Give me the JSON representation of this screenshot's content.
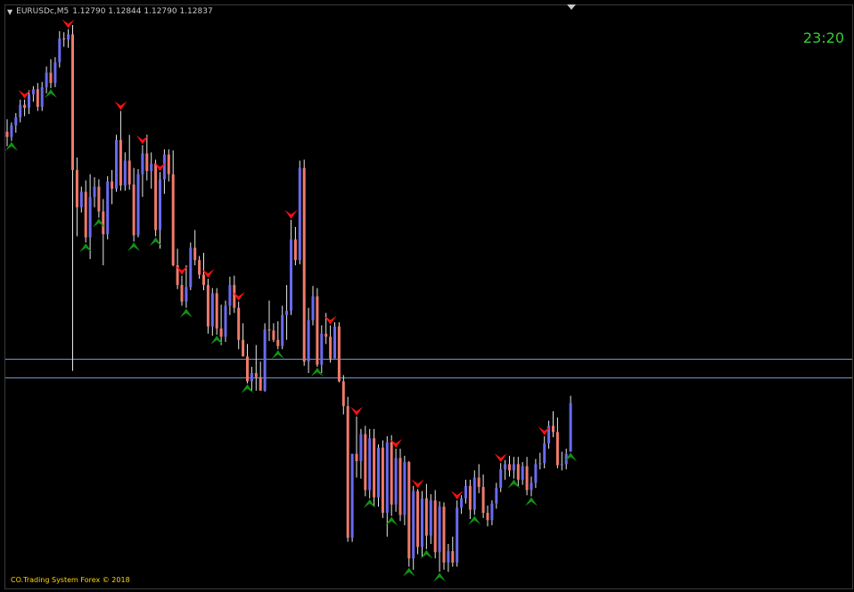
{
  "header": {
    "symbol": "EURUSDc,M5",
    "ohlc": "1.12790 1.12844 1.12790 1.12837"
  },
  "clock": "23:20",
  "footer": "CO.Trading System Forex © 2018",
  "colors": {
    "background": "#000000",
    "bull": "#6a6af0",
    "bear": "#f07a6a",
    "wick": "#e8e8e8",
    "level_line": "#6f98c4",
    "sell_arrow": "#ff1010",
    "buy_arrow": "#129212"
  },
  "chart_data": {
    "type": "candlestick",
    "symbol": "EURUSDc",
    "timeframe": "M5",
    "candles": [
      [
        1.13099,
        1.13111,
        1.13085,
        1.13094
      ],
      [
        1.13094,
        1.13108,
        1.1309,
        1.13105
      ],
      [
        1.13105,
        1.13117,
        1.13098,
        1.13113
      ],
      [
        1.13113,
        1.1313,
        1.13108,
        1.13125
      ],
      [
        1.13125,
        1.1313,
        1.13114,
        1.13122
      ],
      [
        1.13122,
        1.13139,
        1.13116,
        1.13135
      ],
      [
        1.13135,
        1.13143,
        1.13128,
        1.1314
      ],
      [
        1.1314,
        1.13146,
        1.13119,
        1.13123
      ],
      [
        1.13123,
        1.13147,
        1.13119,
        1.13142
      ],
      [
        1.13142,
        1.13162,
        1.13136,
        1.13156
      ],
      [
        1.13156,
        1.13169,
        1.13141,
        1.13146
      ],
      [
        1.13146,
        1.13171,
        1.13142,
        1.13166
      ],
      [
        1.13166,
        1.13196,
        1.13161,
        1.13189
      ],
      [
        1.13189,
        1.13195,
        1.13181,
        1.13188
      ],
      [
        1.13188,
        1.13198,
        1.1318,
        1.13193
      ],
      [
        1.13193,
        1.13202,
        1.12868,
        1.13062
      ],
      [
        1.13062,
        1.13074,
        1.12998,
        1.13026
      ],
      [
        1.13026,
        1.13046,
        1.13021,
        1.13041
      ],
      [
        1.13041,
        1.13052,
        1.12992,
        1.12997
      ],
      [
        1.12997,
        1.13058,
        1.12976,
        1.13036
      ],
      [
        1.13036,
        1.13055,
        1.13026,
        1.13046
      ],
      [
        1.13046,
        1.13053,
        1.13016,
        1.13022
      ],
      [
        1.13022,
        1.13034,
        1.1297,
        1.13
      ],
      [
        1.13,
        1.13056,
        1.12995,
        1.13051
      ],
      [
        1.13051,
        1.13062,
        1.13029,
        1.13044
      ],
      [
        1.13044,
        1.13096,
        1.13041,
        1.13091
      ],
      [
        1.13091,
        1.13119,
        1.13042,
        1.13047
      ],
      [
        1.13047,
        1.13079,
        1.13042,
        1.13071
      ],
      [
        1.13071,
        1.13096,
        1.13043,
        1.13048
      ],
      [
        1.13048,
        1.13064,
        1.12993,
        1.12999
      ],
      [
        1.12999,
        1.13063,
        1.12997,
        1.13058
      ],
      [
        1.13058,
        1.13086,
        1.13036,
        1.13078
      ],
      [
        1.13078,
        1.13096,
        1.13052,
        1.13061
      ],
      [
        1.13061,
        1.13079,
        1.13044,
        1.13068
      ],
      [
        1.13068,
        1.13072,
        1.12998,
        1.13004
      ],
      [
        1.13004,
        1.1306,
        1.12986,
        1.13053
      ],
      [
        1.13053,
        1.13082,
        1.13039,
        1.13077
      ],
      [
        1.13077,
        1.13082,
        1.13051,
        1.13058
      ],
      [
        1.13058,
        1.13081,
        1.12969,
        1.1297
      ],
      [
        1.1297,
        1.12986,
        1.12947,
        1.12951
      ],
      [
        1.12951,
        1.1296,
        1.12931,
        1.12935
      ],
      [
        1.12935,
        1.1297,
        1.12929,
        1.12949
      ],
      [
        1.12949,
        1.12992,
        1.12946,
        1.12987
      ],
      [
        1.12987,
        1.13004,
        1.1297,
        1.12975
      ],
      [
        1.12975,
        1.12979,
        1.12957,
        1.12961
      ],
      [
        1.12961,
        1.12982,
        1.12946,
        1.12951
      ],
      [
        1.12951,
        1.12957,
        1.12904,
        1.12911
      ],
      [
        1.12911,
        1.12948,
        1.12902,
        1.12943
      ],
      [
        1.12943,
        1.12948,
        1.12903,
        1.12909
      ],
      [
        1.12909,
        1.12932,
        1.12893,
        1.12901
      ],
      [
        1.12901,
        1.12936,
        1.12896,
        1.12931
      ],
      [
        1.12931,
        1.12959,
        1.12922,
        1.12951
      ],
      [
        1.12951,
        1.1296,
        1.12924,
        1.12929
      ],
      [
        1.12929,
        1.12935,
        1.12889,
        1.12898
      ],
      [
        1.12898,
        1.12914,
        1.12882,
        1.12882
      ],
      [
        1.12882,
        1.12894,
        1.12856,
        1.12858
      ],
      [
        1.12858,
        1.12872,
        1.12849,
        1.12866
      ],
      [
        1.12866,
        1.12893,
        1.12849,
        1.12862
      ],
      [
        1.12862,
        1.12877,
        1.12849,
        1.12849
      ],
      [
        1.12849,
        1.12914,
        1.12848,
        1.12908
      ],
      [
        1.12908,
        1.12936,
        1.12897,
        1.12907
      ],
      [
        1.12907,
        1.12914,
        1.12896,
        1.12898
      ],
      [
        1.12898,
        1.12916,
        1.12889,
        1.12892
      ],
      [
        1.12892,
        1.12931,
        1.12889,
        1.12922
      ],
      [
        1.12922,
        1.12951,
        1.12898,
        1.12926
      ],
      [
        1.12926,
        1.13014,
        1.12922,
        1.12995
      ],
      [
        1.12995,
        1.13007,
        1.1297,
        1.12975
      ],
      [
        1.12975,
        1.13071,
        1.12971,
        1.13064
      ],
      [
        1.13064,
        1.13072,
        1.12873,
        1.12877
      ],
      [
        1.12877,
        1.12929,
        1.12866,
        1.12917
      ],
      [
        1.12917,
        1.1295,
        1.12912,
        1.1294
      ],
      [
        1.1294,
        1.12948,
        1.12872,
        1.12874
      ],
      [
        1.12874,
        1.12912,
        1.12866,
        1.12904
      ],
      [
        1.12904,
        1.12924,
        1.12894,
        1.12901
      ],
      [
        1.12901,
        1.12912,
        1.12876,
        1.1288
      ],
      [
        1.1288,
        1.12915,
        1.12881,
        1.12911
      ],
      [
        1.12911,
        1.12915,
        1.12857,
        1.12858
      ],
      [
        1.12858,
        1.12864,
        1.12826,
        1.12834
      ],
      [
        1.12834,
        1.12843,
        1.12703,
        1.12707
      ],
      [
        1.12707,
        1.12788,
        1.12703,
        1.12788
      ],
      [
        1.12788,
        1.12824,
        1.12765,
        1.12781
      ],
      [
        1.12781,
        1.12812,
        1.12764,
        1.12807
      ],
      [
        1.12807,
        1.12815,
        1.12747,
        1.12753
      ],
      [
        1.12753,
        1.12812,
        1.12745,
        1.12803
      ],
      [
        1.12803,
        1.12812,
        1.12737,
        1.12746
      ],
      [
        1.12746,
        1.12797,
        1.12737,
        1.12794
      ],
      [
        1.12794,
        1.12801,
        1.12726,
        1.12731
      ],
      [
        1.12731,
        1.12805,
        1.12708,
        1.12799
      ],
      [
        1.12799,
        1.12806,
        1.12728,
        1.12739
      ],
      [
        1.12739,
        1.12793,
        1.12732,
        1.12784
      ],
      [
        1.12784,
        1.12793,
        1.12723,
        1.12729
      ],
      [
        1.12729,
        1.12786,
        1.12719,
        1.1278
      ],
      [
        1.1278,
        1.12781,
        1.12679,
        1.12687
      ],
      [
        1.12687,
        1.12757,
        1.12676,
        1.12752
      ],
      [
        1.12752,
        1.12754,
        1.12691,
        1.12698
      ],
      [
        1.12698,
        1.12752,
        1.12688,
        1.12745
      ],
      [
        1.12745,
        1.12759,
        1.12696,
        1.12709
      ],
      [
        1.12709,
        1.12749,
        1.12701,
        1.12743
      ],
      [
        1.12743,
        1.12753,
        1.12687,
        1.12693
      ],
      [
        1.12693,
        1.12742,
        1.12674,
        1.12737
      ],
      [
        1.12737,
        1.12741,
        1.12676,
        1.12683
      ],
      [
        1.12683,
        1.12701,
        1.12674,
        1.12694
      ],
      [
        1.12694,
        1.12708,
        1.12679,
        1.12683
      ],
      [
        1.12683,
        1.12743,
        1.12679,
        1.12736
      ],
      [
        1.12736,
        1.12748,
        1.1273,
        1.12745
      ],
      [
        1.12745,
        1.12763,
        1.1274,
        1.12757
      ],
      [
        1.12757,
        1.12763,
        1.12725,
        1.12734
      ],
      [
        1.12734,
        1.12772,
        1.12729,
        1.12765
      ],
      [
        1.12765,
        1.12778,
        1.1275,
        1.12756
      ],
      [
        1.12756,
        1.12768,
        1.12726,
        1.12731
      ],
      [
        1.12731,
        1.12738,
        1.12718,
        1.12724
      ],
      [
        1.12724,
        1.12743,
        1.12719,
        1.1274
      ],
      [
        1.1274,
        1.1276,
        1.12735,
        1.12755
      ],
      [
        1.12755,
        1.12779,
        1.12751,
        1.12773
      ],
      [
        1.12773,
        1.12782,
        1.12763,
        1.12778
      ],
      [
        1.12778,
        1.12786,
        1.12766,
        1.12772
      ],
      [
        1.12772,
        1.12785,
        1.12764,
        1.12778
      ],
      [
        1.12778,
        1.12785,
        1.12756,
        1.12763
      ],
      [
        1.12763,
        1.1278,
        1.12758,
        1.12776
      ],
      [
        1.12776,
        1.12785,
        1.12748,
        1.12753
      ],
      [
        1.12753,
        1.12766,
        1.12747,
        1.1276
      ],
      [
        1.1276,
        1.12783,
        1.12755,
        1.12778
      ],
      [
        1.12778,
        1.12789,
        1.12773,
        1.12779
      ],
      [
        1.12779,
        1.12805,
        1.12774,
        1.12798
      ],
      [
        1.12798,
        1.1282,
        1.12793,
        1.12815
      ],
      [
        1.12815,
        1.12829,
        1.12804,
        1.12809
      ],
      [
        1.12809,
        1.12823,
        1.12774,
        1.12777
      ],
      [
        1.12777,
        1.1279,
        1.12772,
        1.12778
      ],
      [
        1.12778,
        1.12793,
        1.12773,
        1.12788
      ],
      [
        1.1279,
        1.12844,
        1.1279,
        1.12837
      ]
    ],
    "levels": [
      1.1288,
      1.12862
    ],
    "sell_signals": [
      4,
      14,
      26,
      31,
      35,
      40,
      46,
      53,
      65,
      74,
      80,
      89,
      94,
      103,
      113,
      123
    ],
    "buy_signals": [
      1,
      10,
      18,
      21,
      29,
      34,
      41,
      48,
      55,
      62,
      71,
      83,
      88,
      92,
      96,
      99,
      107,
      116,
      120,
      129
    ],
    "ylim": [
      1.12658,
      1.13221
    ],
    "grid": false
  }
}
